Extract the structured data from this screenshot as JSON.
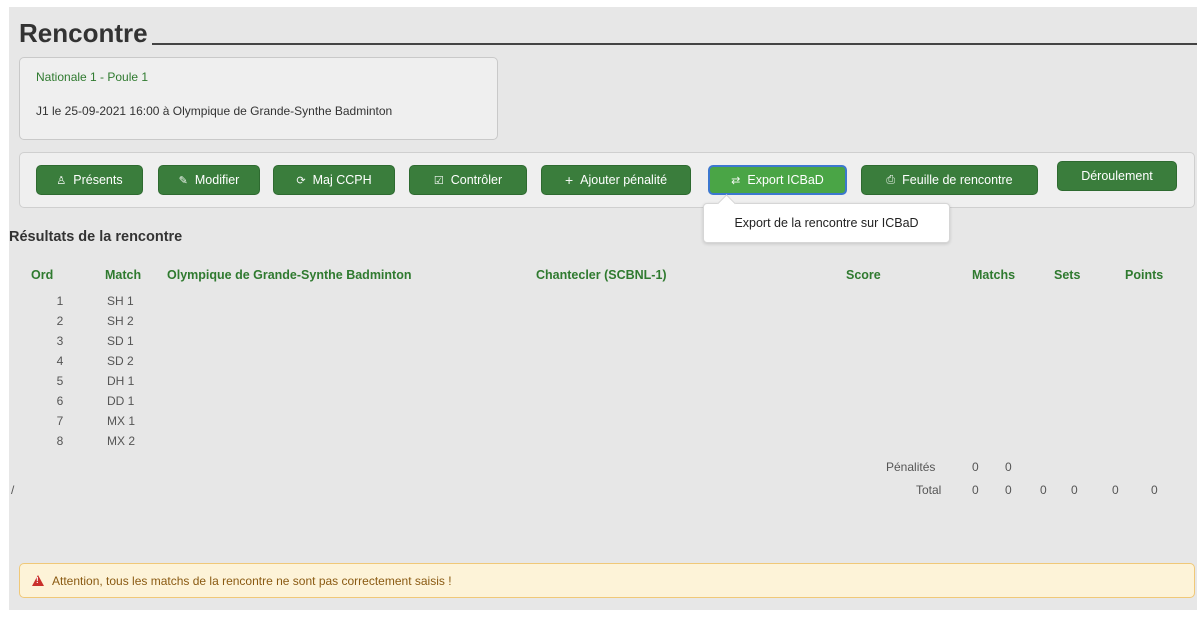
{
  "page": {
    "title": "Rencontre"
  },
  "info": {
    "competition": "Nationale 1 - Poule 1",
    "meta": "J1 le 25-09-2021 16:00 à Olympique de Grande-Synthe Badminton"
  },
  "toolbar": {
    "presents": "Présents",
    "modifier": "Modifier",
    "maj_ccph": "Maj CCPH",
    "controler": "Contrôler",
    "penalite": "Ajouter pénalité",
    "export": "Export ICBaD",
    "feuille": "Feuille de rencontre",
    "deroulement": "Déroulement"
  },
  "tooltip": "Export de la rencontre sur ICBaD",
  "results": {
    "title": "Résultats de la rencontre",
    "headers": {
      "ord": "Ord",
      "match": "Match",
      "team1": "Olympique de Grande-Synthe Badminton",
      "team2": "Chantecler (SCBNL-1)",
      "score": "Score",
      "matchs": "Matchs",
      "sets": "Sets",
      "points": "Points"
    },
    "rows": [
      {
        "ord": "1",
        "match": "SH 1"
      },
      {
        "ord": "2",
        "match": "SH 2"
      },
      {
        "ord": "3",
        "match": "SD 1"
      },
      {
        "ord": "4",
        "match": "SD 2"
      },
      {
        "ord": "5",
        "match": "DH 1"
      },
      {
        "ord": "6",
        "match": "DD 1"
      },
      {
        "ord": "7",
        "match": "MX 1"
      },
      {
        "ord": "8",
        "match": "MX 2"
      }
    ],
    "penalites": {
      "label": "Pénalités",
      "m1": "0",
      "m2": "0"
    },
    "total": {
      "label": "Total",
      "m1": "0",
      "m2": "0",
      "s1": "0",
      "s2": "0",
      "p1": "0",
      "p2": "0"
    },
    "slash": "/"
  },
  "alert": "Attention, tous les matchs de la rencontre ne sont pas correctement saisis !"
}
